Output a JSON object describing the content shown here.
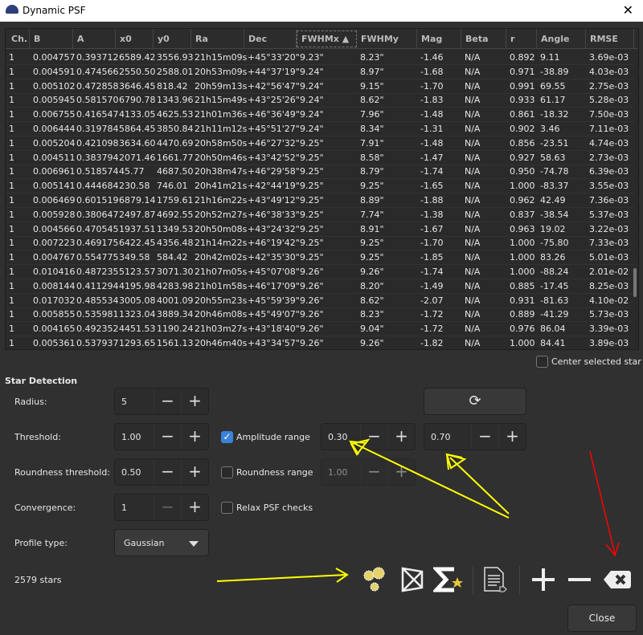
{
  "window": {
    "title": "Dynamic PSF",
    "close_icon": "close-icon"
  },
  "table": {
    "columns": [
      "Ch.",
      "B",
      "A",
      "x0",
      "y0",
      "Ra",
      "Dec",
      "FWHMx",
      "FWHMy",
      "Mag",
      "Beta",
      "r",
      "Angle",
      "RMSE"
    ],
    "sorted_column": "FWHMx",
    "sort_direction": "ascending",
    "rows": [
      [
        "1",
        "0.004757",
        "0.393712",
        "6589.42",
        "3556.93",
        "21h15m09s",
        "+45°33'20\"",
        "9.23\"",
        "8.23\"",
        "-1.46",
        "N/A",
        "0.892",
        "9.11",
        "3.69e-03"
      ],
      [
        "1",
        "0.004591",
        "0.474566",
        "2550.50",
        "2588.01",
        "20h53m09s",
        "+44°37'19\"",
        "9.24\"",
        "8.97\"",
        "-1.68",
        "N/A",
        "0.971",
        "-38.89",
        "4.03e-03"
      ],
      [
        "1",
        "0.005102",
        "0.472858",
        "3646.45",
        "818.42",
        "20h59m13s",
        "+42°56'47\"",
        "9.24\"",
        "9.15\"",
        "-1.70",
        "N/A",
        "0.991",
        "69.55",
        "2.75e-03"
      ],
      [
        "1",
        "0.005945",
        "0.581570",
        "6790.78",
        "1343.96",
        "21h15m49s",
        "+43°25'26\"",
        "9.24\"",
        "8.62\"",
        "-1.83",
        "N/A",
        "0.933",
        "61.17",
        "5.28e-03"
      ],
      [
        "1",
        "0.006755",
        "0.416547",
        "4133.05",
        "4625.53",
        "21h01m36s",
        "+46°36'49\"",
        "9.24\"",
        "7.96\"",
        "-1.48",
        "N/A",
        "0.861",
        "-18.32",
        "7.50e-03"
      ],
      [
        "1",
        "0.006444",
        "0.319784",
        "5864.45",
        "3850.84",
        "21h11m12s",
        "+45°51'27\"",
        "9.24\"",
        "8.34\"",
        "-1.31",
        "N/A",
        "0.902",
        "3.46",
        "7.11e-03"
      ],
      [
        "1",
        "0.005204",
        "0.421098",
        "3634.60",
        "4470.69",
        "20h58m50s",
        "+46°27'32\"",
        "9.25\"",
        "7.91\"",
        "-1.48",
        "N/A",
        "0.856",
        "-23.51",
        "4.74e-03"
      ],
      [
        "1",
        "0.004511",
        "0.383794",
        "2071.46",
        "1661.77",
        "20h50m46s",
        "+43°42'52\"",
        "9.25\"",
        "8.58\"",
        "-1.47",
        "N/A",
        "0.927",
        "58.63",
        "2.73e-03"
      ],
      [
        "1",
        "0.006961",
        "0.518574",
        "45.77",
        "4687.50",
        "20h38m47s",
        "+46°29'58\"",
        "9.25\"",
        "8.79\"",
        "-1.74",
        "N/A",
        "0.950",
        "-74.78",
        "6.39e-03"
      ],
      [
        "1",
        "0.005141",
        "0.444684",
        "230.58",
        "746.01",
        "20h41m21s",
        "+42°44'19\"",
        "9.25\"",
        "9.25\"",
        "-1.65",
        "N/A",
        "1.000",
        "-83.37",
        "3.55e-03"
      ],
      [
        "1",
        "0.006469",
        "0.601519",
        "6879.14",
        "1759.61",
        "21h16m22s",
        "+43°49'12\"",
        "9.25\"",
        "8.89\"",
        "-1.88",
        "N/A",
        "0.962",
        "42.49",
        "7.36e-03"
      ],
      [
        "1",
        "0.005928",
        "0.380647",
        "2497.87",
        "4692.55",
        "20h52m27s",
        "+46°38'33\"",
        "9.25\"",
        "7.74\"",
        "-1.38",
        "N/A",
        "0.837",
        "-38.54",
        "5.37e-03"
      ],
      [
        "1",
        "0.004566",
        "0.470545",
        "1937.51",
        "1349.53",
        "20h50m08s",
        "+43°24'32\"",
        "9.25\"",
        "8.91\"",
        "-1.67",
        "N/A",
        "0.963",
        "19.02",
        "3.22e-03"
      ],
      [
        "1",
        "0.007223",
        "0.469175",
        "6422.45",
        "4356.48",
        "21h14m22s",
        "+46°19'42\"",
        "9.25\"",
        "9.25\"",
        "-1.70",
        "N/A",
        "1.000",
        "-75.80",
        "7.33e-03"
      ],
      [
        "1",
        "0.004767",
        "0.554775",
        "349.58",
        "584.42",
        "20h42m02s",
        "+42°35'30\"",
        "9.25\"",
        "9.25\"",
        "-1.85",
        "N/A",
        "1.000",
        "83.26",
        "5.01e-03"
      ],
      [
        "1",
        "0.010416",
        "0.487235",
        "5123.57",
        "3071.30",
        "21h07m05s",
        "+45°07'08\"",
        "9.26\"",
        "9.26\"",
        "-1.74",
        "N/A",
        "1.000",
        "-88.24",
        "2.01e-02"
      ],
      [
        "1",
        "0.008144",
        "0.411294",
        "4195.98",
        "4283.98",
        "21h01m58s",
        "+46°17'09\"",
        "9.26\"",
        "8.20\"",
        "-1.49",
        "N/A",
        "0.885",
        "-17.45",
        "8.25e-03"
      ],
      [
        "1",
        "0.017032",
        "0.485534",
        "3005.08",
        "4001.09",
        "20h55m23s",
        "+45°59'39\"",
        "9.26\"",
        "8.62\"",
        "-2.07",
        "N/A",
        "0.931",
        "-81.63",
        "4.10e-02"
      ],
      [
        "1",
        "0.005855",
        "0.535981",
        "1323.04",
        "3889.34",
        "20h46m08s",
        "+45°49'07\"",
        "9.26\"",
        "8.23\"",
        "-1.72",
        "N/A",
        "0.889",
        "-41.29",
        "5.73e-03"
      ],
      [
        "1",
        "0.004165",
        "0.492352",
        "4451.53",
        "1190.24",
        "21h03m27s",
        "+43°18'40\"",
        "9.26\"",
        "9.04\"",
        "-1.72",
        "N/A",
        "0.976",
        "86.04",
        "3.39e-03"
      ],
      [
        "1",
        "0.005361",
        "0.537937",
        "1293.65",
        "1561.13",
        "20h46m40s",
        "+43°34'57\"",
        "9.26\"",
        "9.26\"",
        "-1.82",
        "N/A",
        "1.000",
        "84.41",
        "3.89e-03"
      ]
    ]
  },
  "center_selected_star": {
    "label": "Center selected star",
    "checked": false
  },
  "star_detection": {
    "heading": "Star Detection",
    "radius": {
      "label": "Radius:",
      "value": "5"
    },
    "threshold": {
      "label": "Threshold:",
      "value": "1.00"
    },
    "roundness_threshold": {
      "label": "Roundness threshold:",
      "value": "0.50"
    },
    "convergence": {
      "label": "Convergence:",
      "value": "1"
    },
    "profile_type": {
      "label": "Profile type:",
      "value": "Gaussian"
    },
    "amplitude_range": {
      "label": "Amplitude range",
      "checked": true,
      "min": "0.30",
      "max": "0.70"
    },
    "roundness_range": {
      "label": "Roundness range",
      "checked": false,
      "min": "1.00"
    },
    "relax_psf_checks": {
      "label": "Relax PSF checks",
      "checked": false
    },
    "minus": "−",
    "plus": "+"
  },
  "status": {
    "star_count": "2579 stars"
  },
  "toolbar": {
    "icons": [
      "find-stars-icon",
      "mosaic-icon",
      "average-psf-icon",
      "export-document-icon",
      "add-star-icon",
      "remove-star-icon",
      "clear-all-icon"
    ]
  },
  "footer": {
    "close_label": "Close"
  },
  "annotation_colors": {
    "yellow": "#ffff00",
    "red": "#ff0000"
  }
}
